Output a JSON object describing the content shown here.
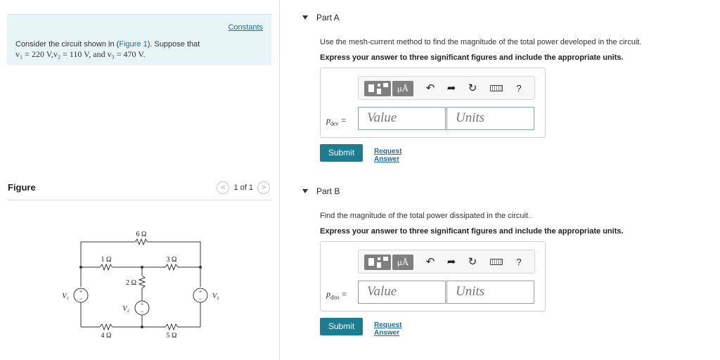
{
  "constants_link": "Constants",
  "intro": {
    "line1_prefix": "Consider the circuit shown in (",
    "figure_link": "Figure 1",
    "line1_suffix": "). Suppose that",
    "line2": "v₁ = 220 V,v₂ = 110 V, and v₃ = 470 V."
  },
  "figure": {
    "label": "Figure",
    "pager_text": "1 of 1",
    "prev_icon": "chevron-left-icon",
    "next_icon": "chevron-right-icon"
  },
  "circuit": {
    "r_top": "6 Ω",
    "r_1": "1 Ω",
    "r_3": "3 Ω",
    "r_2": "2 Ω",
    "r_4": "4 Ω",
    "r_5": "5 Ω",
    "v1": "V₁",
    "v2": "V₂",
    "v3": "V₃"
  },
  "toolbar": {
    "units_label": "μÅ",
    "help_label": "?",
    "icons": [
      "templates-icon",
      "units-icon",
      "undo-icon",
      "redo-icon",
      "reset-icon",
      "keyboard-icon",
      "help-icon"
    ]
  },
  "part_a": {
    "title": "Part A",
    "question": "Use the mesh-current method to find the magnitude of the total power developed in the circuit.",
    "instruction": "Express your answer to three significant figures and include the appropriate units.",
    "var_main": "p",
    "var_sub": "dev",
    "value_placeholder": "Value",
    "units_placeholder": "Units",
    "submit_label": "Submit",
    "request_label": "Request Answer"
  },
  "part_b": {
    "title": "Part B",
    "question": "Find the magnitude of the total power dissipated in the circuit.",
    "instruction": "Express your answer to three significant figures and include the appropriate units.",
    "var_main": "p",
    "var_sub": "diss",
    "value_placeholder": "Value",
    "units_placeholder": "Units",
    "submit_label": "Submit",
    "request_label": "Request Answer"
  }
}
